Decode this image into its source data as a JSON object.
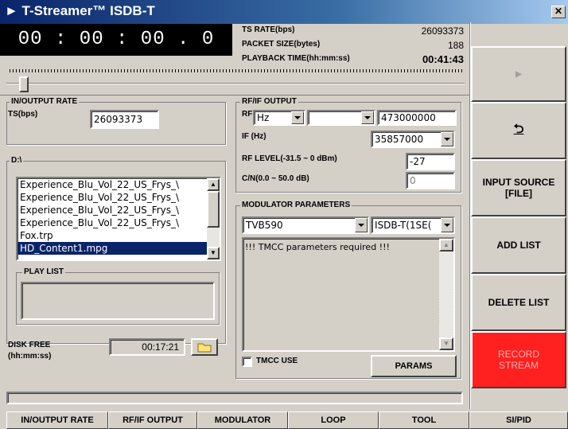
{
  "window": {
    "title": "► T-Streamer™ ISDB-T",
    "close": "✕"
  },
  "player": {
    "time": "00 : 00 : 00 . 0"
  },
  "info": {
    "ts_rate_label": "TS RATE(bps)",
    "ts_rate_value": "26093373",
    "packet_size_label": "PACKET SIZE(bytes)",
    "packet_size_value": "188",
    "playback_label": "PLAYBACK TIME(hh:mm:ss)",
    "playback_value": "00:41:43"
  },
  "io_rate": {
    "title": "IN/OUTPUT RATE",
    "ts_label": "TS(bps)",
    "ts_value": "26093373"
  },
  "rf": {
    "title": "RF/IF OUTPUT",
    "rf_label": "RF",
    "unit": "Hz",
    "rf_select": "",
    "freq": "473000000",
    "if_label": "IF (Hz)",
    "if_value": "35857000",
    "level_label": "RF LEVEL(-31.5 ~ 0 dBm)",
    "level_value": "-27",
    "cn_label": "C/N(0.0 ~ 50.0 dB)",
    "cn_value": "0"
  },
  "files": {
    "title": "D:\\",
    "items": [
      "Experience_Blu_Vol_22_US_Frys_\\",
      "Experience_Blu_Vol_22_US_Frys_\\",
      "Experience_Blu_Vol_22_US_Frys_\\",
      "Experience_Blu_Vol_22_US_Frys_\\",
      "Fox.trp",
      "HD_Content1.mpg"
    ]
  },
  "playlist": {
    "title": "PLAY LIST"
  },
  "disk": {
    "label1": "DISK FREE",
    "label2": "(hh:mm:ss)",
    "value": "00:17:21"
  },
  "modulator": {
    "title": "MODULATOR PARAMETERS",
    "device": "TVB590",
    "mode": "ISDB-T(1SE(",
    "message": "!!! TMCC parameters required !!!",
    "tmcc_label": "TMCC USE",
    "params_btn": "PARAMS"
  },
  "sidebar": {
    "play": "▶",
    "back": "⮌",
    "input_source": "INPUT SOURCE [FILE]",
    "add_list": "ADD LIST",
    "delete_list": "DELETE LIST",
    "record": "RECORD STREAM"
  },
  "colors": {
    "record_bg": "#ff2020",
    "record_text": "#ffb0b0",
    "selection": "#0a246a"
  },
  "tabs": [
    "IN/OUTPUT RATE",
    "RF/IF OUTPUT",
    "MODULATOR",
    "LOOP",
    "TOOL",
    "SI/PID"
  ]
}
